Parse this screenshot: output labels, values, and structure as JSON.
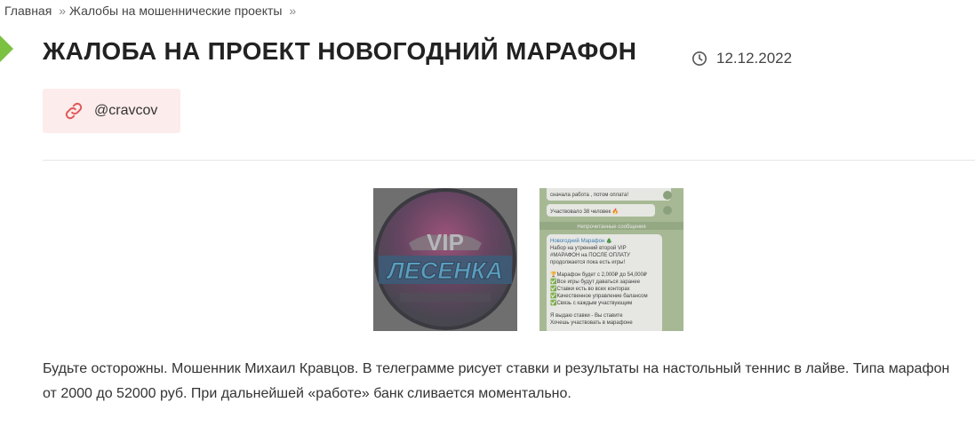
{
  "breadcrumb": {
    "home": "Главная",
    "separator": "»",
    "section": "Жалобы на мошеннические проекты"
  },
  "article": {
    "title": "ЖАЛОБА НА ПРОЕКТ НОВОГОДНИЙ МАРАФОН",
    "date": "12.12.2022",
    "tag": "@cravcov",
    "body": "Будьте осторожны. Мошенник Михаил Кравцов. В телеграмме рисует ставки и результаты на настольный теннис в лайве. Типа марафон от 2000 до 52000 руб. При дальнейшей «работе» банк сливается моментально."
  },
  "images": {
    "logo": {
      "line1": "VIP",
      "line2": "ЛЕСЕНКА"
    },
    "chat": {
      "lines": [
        "сначала работа , потом оплата!",
        "Участвовало 38 человек 🔥",
        "Непрочитанные сообщения",
        "Новогодний Марафон 🎄",
        "Набор на утренний второй VIP",
        "#МАРАФОН на ПОСЛЕ ОПЛАТУ",
        "продолжается пока есть игры!",
        "🏆Марафон будет с 2,000₽ до 54,000₽",
        "✅Все игры будут даваться заранее",
        "✅Ставки есть во всех конторах",
        "✅Качественное управление балансом",
        "✅Связь с каждым участвующим",
        "Я выдаю ставки - Вы ставите",
        "Хочешь участвовать в марафоне"
      ]
    }
  },
  "colors": {
    "accent_green": "#7cc242",
    "tag_bg": "#fdecec",
    "link_icon": "#e05a5a"
  }
}
